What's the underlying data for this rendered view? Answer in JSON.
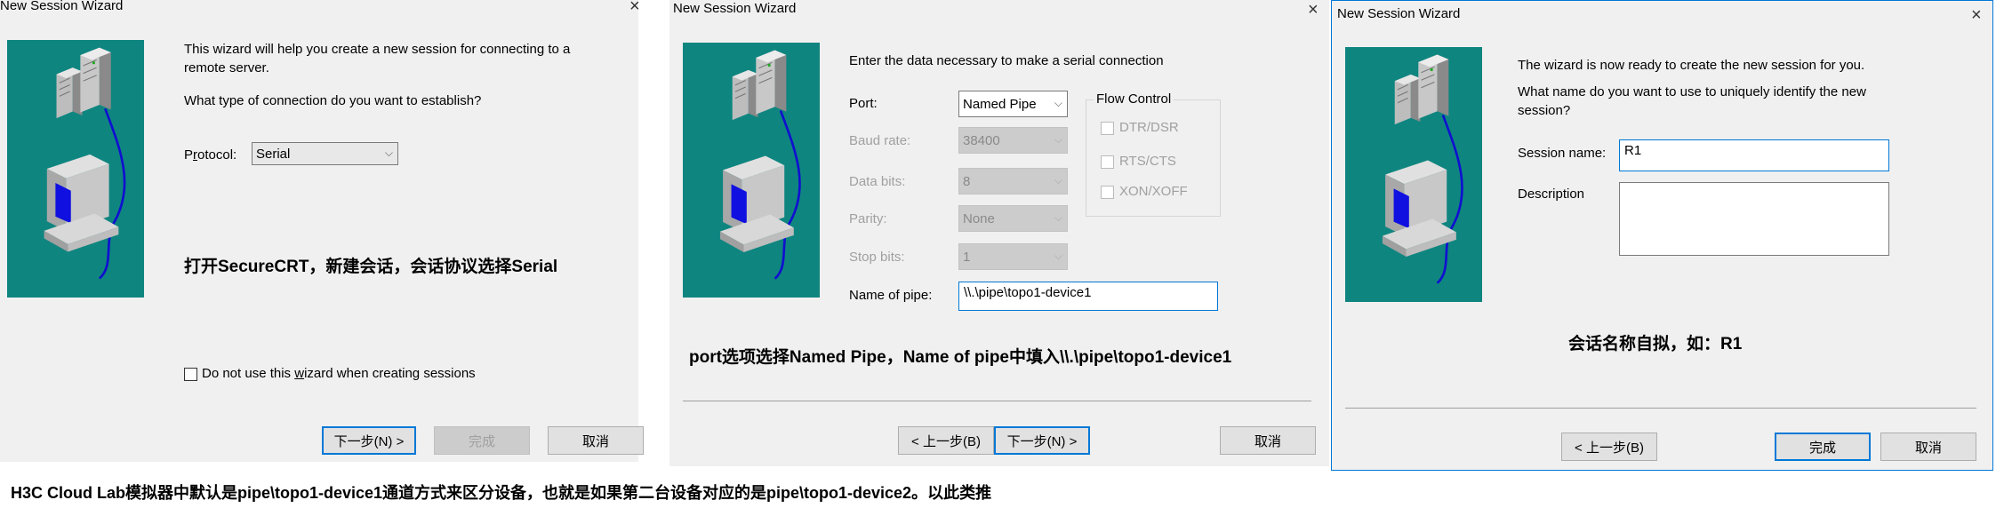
{
  "dialog1": {
    "title": "New Session Wizard",
    "intro": "This wizard will help you create a new session for connecting to a",
    "intro2": "remote server.",
    "question": "What type of connection do you want to establish?",
    "protocol_label_pre": "P",
    "protocol_label_u": "r",
    "protocol_label_post": "otocol:",
    "protocol_value": "Serial",
    "note": "打开SecureCRT，新建会话，会话协议选择Serial",
    "checkbox_pre": "Do not use this ",
    "checkbox_u": "w",
    "checkbox_post": "izard when creating sessions",
    "next_button": "下一步(N) >",
    "finish_button": "完成",
    "cancel_button": "取消"
  },
  "dialog2": {
    "title": "New Session Wizard",
    "intro": "Enter the data necessary to make a serial connection",
    "port_label": "Port:",
    "port_value": "Named Pipe",
    "baud_label": "Baud rate:",
    "baud_value": "38400",
    "databits_label": "Data bits:",
    "databits_value": "8",
    "parity_label": "Parity:",
    "parity_value": "None",
    "stopbits_label": "Stop bits:",
    "stopbits_value": "1",
    "pipe_label": "Name of pipe:",
    "pipe_value": "\\\\.\\pipe\\topo1-device1",
    "flow_title": "Flow Control",
    "flow_items": [
      "DTR/DSR",
      "RTS/CTS",
      "XON/XOFF"
    ],
    "note": "port选项选择Named Pipe，Name of pipe中填入\\\\.\\pipe\\topo1-device1",
    "back_button": "< 上一步(B)",
    "next_button": "下一步(N) >",
    "cancel_button": "取消"
  },
  "dialog3": {
    "title": "New Session Wizard",
    "intro": "The wizard is now ready to create the new session for you.",
    "question": "What name do you want to use to uniquely identify the new",
    "question2": "session?",
    "session_label": "Session name:",
    "session_value": "R1",
    "description_label": "Description",
    "note": "会话名称自拟，如：R1",
    "back_button": "< 上一步(B)",
    "finish_button": "完成",
    "cancel_button": "取消"
  },
  "footer_note": "H3C Cloud Lab模拟器中默认是pipe\\topo1-device1通道方式来区分设备，也就是如果第二台设备对应的是pipe\\topo1-device2。以此类推",
  "colors": {
    "art_bg": "#0f8580",
    "accent": "#0078d7"
  }
}
